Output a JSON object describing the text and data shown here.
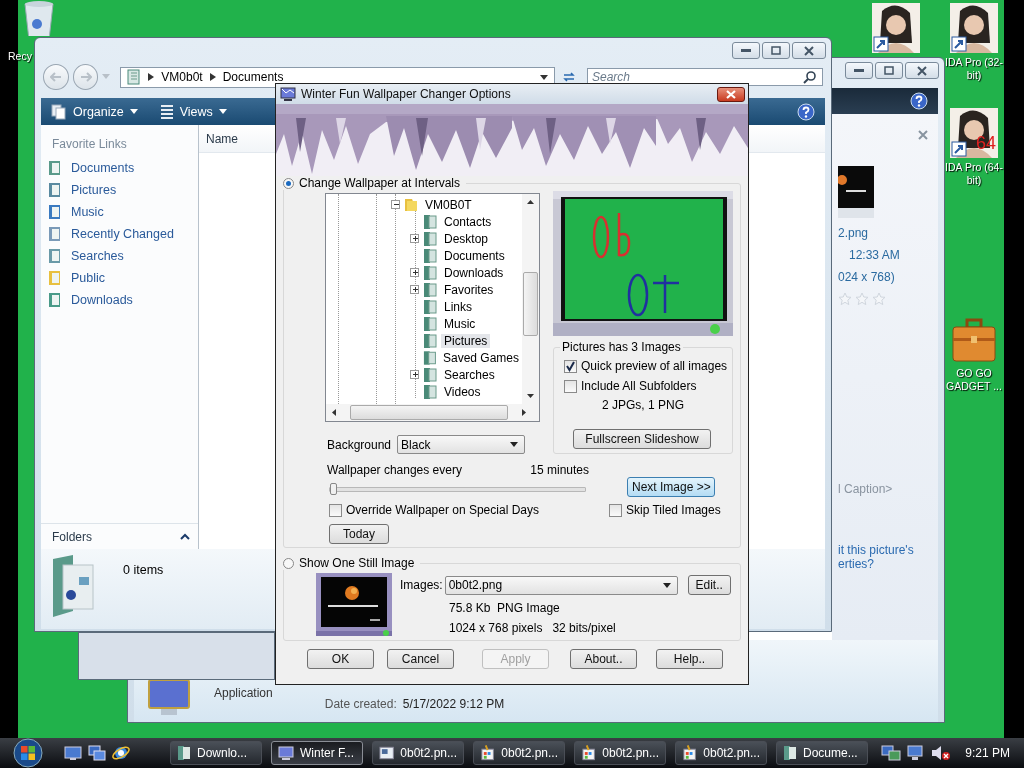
{
  "desktop": {
    "icons": [
      {
        "kind": "recycle-bin",
        "label": "Recy"
      },
      {
        "kind": "portrait"
      },
      {
        "kind": "portrait",
        "label": "IDA Pro (32-bit)"
      },
      {
        "kind": "portrait",
        "label": "IDA Pro (64-bit)",
        "badge": "64"
      },
      {
        "kind": "briefcase",
        "label": "GO GO GADGET ..."
      }
    ]
  },
  "back_window": {
    "preview_lines": [
      "2.png",
      "12:33 AM",
      "024 x 768)"
    ],
    "stars": 0,
    "caption": "l Caption>",
    "link_lines": [
      "it this picture's",
      "erties?"
    ],
    "type": "Application",
    "date_label": "Date created:",
    "date_value": "5/17/2022 9:12 PM"
  },
  "explorer": {
    "path": [
      "VM0b0t",
      "Documents"
    ],
    "search": {
      "placeholder": "Search"
    },
    "toolbar": [
      "Organize",
      "Views"
    ],
    "column": "Name",
    "nav_title": "Favorite Links",
    "links": [
      {
        "label": "Documents",
        "kind": "documents"
      },
      {
        "label": "Pictures",
        "kind": "pictures"
      },
      {
        "label": "Music",
        "kind": "music"
      },
      {
        "label": "Recently Changed",
        "kind": "recent"
      },
      {
        "label": "Searches",
        "kind": "searches"
      },
      {
        "label": "Public",
        "kind": "public"
      },
      {
        "label": "Downloads",
        "kind": "downloads"
      }
    ],
    "folders_label": "Folders",
    "status": "0 items"
  },
  "dialog": {
    "title": "Winter Fun Wallpaper Changer Options",
    "modes": [
      {
        "label": "Change Wallpaper at Intervals",
        "selected": true
      },
      {
        "label": "Show One Still Image",
        "selected": false
      }
    ],
    "tree": {
      "label": "VM0B0T",
      "expanded": true,
      "children": [
        {
          "label": "Contacts",
          "has_children": false,
          "selected": false
        },
        {
          "label": "Desktop",
          "has_children": true,
          "selected": false
        },
        {
          "label": "Documents",
          "has_children": false,
          "selected": false
        },
        {
          "label": "Downloads",
          "has_children": true,
          "selected": false
        },
        {
          "label": "Favorites",
          "has_children": true,
          "selected": false
        },
        {
          "label": "Links",
          "has_children": false,
          "selected": false
        },
        {
          "label": "Music",
          "has_children": false,
          "selected": false
        },
        {
          "label": "Pictures",
          "has_children": false,
          "selected": true
        },
        {
          "label": "Saved Games",
          "has_children": false,
          "selected": false
        },
        {
          "label": "Searches",
          "has_children": true,
          "selected": false
        },
        {
          "label": "Videos",
          "has_children": false,
          "selected": false
        }
      ]
    },
    "folder_group": {
      "title": "Pictures has 3 Images",
      "options": [
        {
          "label": "Quick preview of all images",
          "checked": true
        },
        {
          "label": "Include All Subfolders",
          "checked": false
        }
      ],
      "summary": "2 JPGs, 1 PNG",
      "button": "Fullscreen Slideshow"
    },
    "background": {
      "label": "Background",
      "value": "Black"
    },
    "interval": {
      "label": "Wallpaper changes every",
      "reading": "15 minutes",
      "level": 0
    },
    "next_button": {
      "label": "Next Image >>",
      "hovered": true
    },
    "options": [
      {
        "label": "Override Wallpaper on Special Days",
        "checked": false
      },
      {
        "label": "Skip Tiled Images",
        "checked": false
      }
    ],
    "today_button": "Today",
    "still": {
      "label": "Images:",
      "value": "0b0t2.png",
      "edit": "Edit..",
      "info": [
        "75.8 Kb  PNG Image",
        "1024 x 768 pixels   32 bits/pixel"
      ]
    },
    "buttons": [
      {
        "label": "OK",
        "disabled": false
      },
      {
        "label": "Cancel",
        "disabled": false
      },
      {
        "label": "Apply",
        "disabled": true
      },
      {
        "label": "About..",
        "disabled": false
      },
      {
        "label": "Help..",
        "disabled": false
      }
    ]
  },
  "taskbar": {
    "tasks": [
      {
        "label": "Downlo...",
        "kind": "folder",
        "selected": false
      },
      {
        "label": "Winter F...",
        "kind": "app",
        "selected": true
      },
      {
        "label": "0b0t2.pn...",
        "kind": "viewer",
        "selected": false
      },
      {
        "label": "0b0t2.pn...",
        "kind": "paint",
        "selected": false
      },
      {
        "label": "0b0t2.pn...",
        "kind": "paint",
        "selected": false
      },
      {
        "label": "0b0t2.pn...",
        "kind": "paint",
        "selected": false
      },
      {
        "label": "Docume...",
        "kind": "folder",
        "selected": false
      }
    ],
    "muted": true,
    "clock": "9:21 PM"
  }
}
